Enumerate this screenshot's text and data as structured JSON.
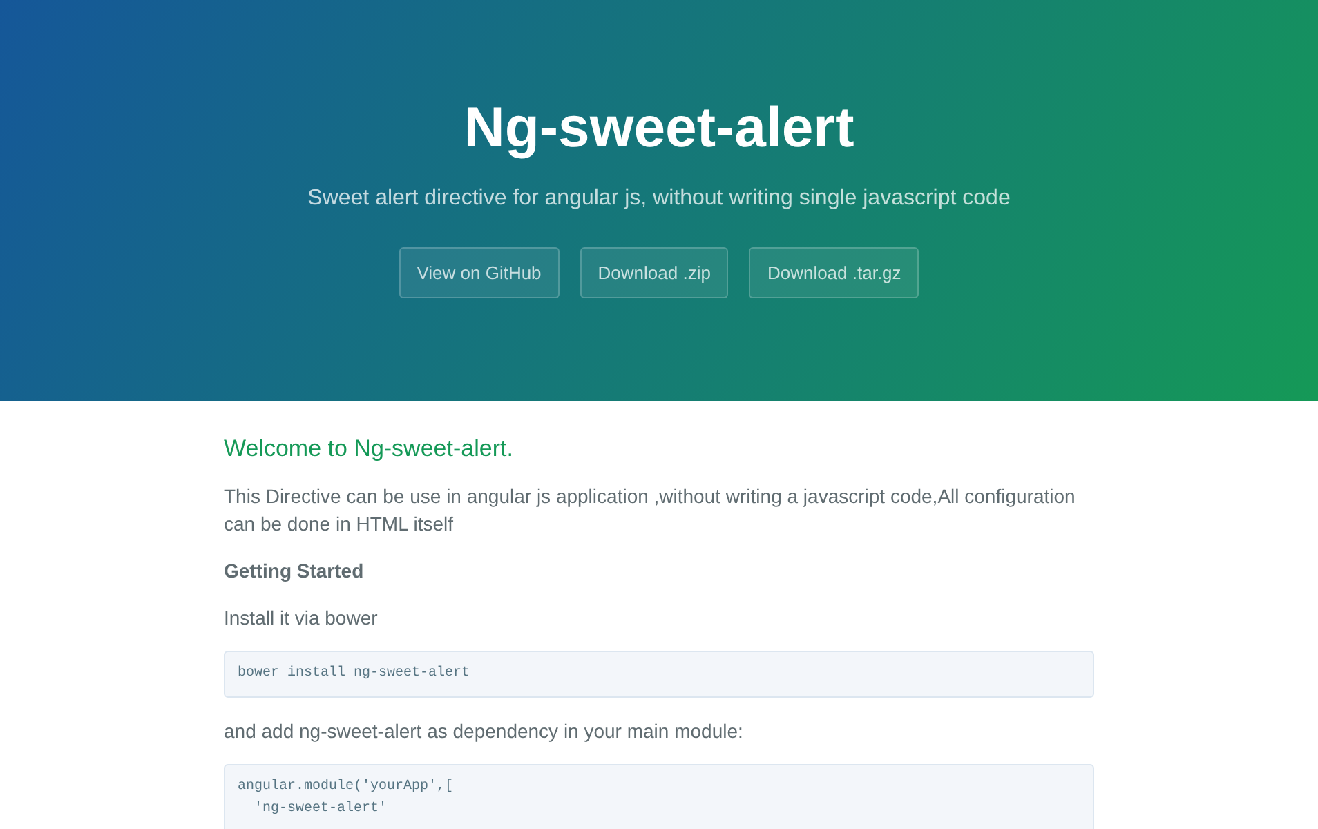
{
  "header": {
    "title": "Ng-sweet-alert",
    "tagline": "Sweet alert directive for angular js, without writing single javascript code",
    "buttons": [
      "View on GitHub",
      "Download .zip",
      "Download .tar.gz"
    ]
  },
  "content": {
    "blocks": [
      {
        "kind": "heading",
        "text": "Welcome to Ng-sweet-alert."
      },
      {
        "kind": "paragraph",
        "text": "This Directive can be use in angular js application ,without writing a javascript code,All configuration can be done in HTML itself"
      },
      {
        "kind": "subheading",
        "text": "Getting Started"
      },
      {
        "kind": "paragraph",
        "text": "Install it via bower"
      },
      {
        "kind": "code",
        "lines": [
          "bower install ng-sweet-alert"
        ]
      },
      {
        "kind": "paragraph",
        "text": "and add ng-sweet-alert as dependency in your main module:"
      },
      {
        "kind": "code",
        "lines": [
          "angular.module('yourApp',[",
          "  'ng-sweet-alert'"
        ]
      }
    ]
  }
}
